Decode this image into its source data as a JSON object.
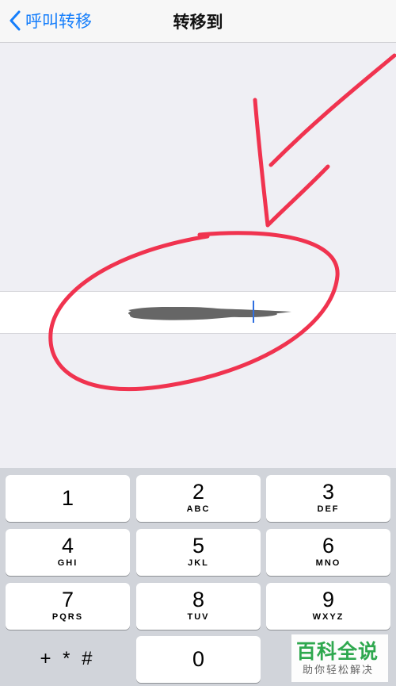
{
  "nav": {
    "back_label": "呼叫转移",
    "title": "转移到"
  },
  "input": {
    "value": "",
    "placeholder": ""
  },
  "keypad": {
    "keys": [
      {
        "digit": "1",
        "letters": ""
      },
      {
        "digit": "2",
        "letters": "ABC"
      },
      {
        "digit": "3",
        "letters": "DEF"
      },
      {
        "digit": "4",
        "letters": "GHI"
      },
      {
        "digit": "5",
        "letters": "JKL"
      },
      {
        "digit": "6",
        "letters": "MNO"
      },
      {
        "digit": "7",
        "letters": "PQRS"
      },
      {
        "digit": "8",
        "letters": "TUV"
      },
      {
        "digit": "9",
        "letters": "WXYZ"
      },
      {
        "digit": "+ * #",
        "letters": ""
      },
      {
        "digit": "0",
        "letters": ""
      }
    ]
  },
  "watermark": {
    "main": "百科全说",
    "sub": "助你轻松解决"
  },
  "colors": {
    "accent": "#157efb",
    "annotation": "#f0334f",
    "background": "#efeff4",
    "keypad_bg": "#d1d4da"
  }
}
